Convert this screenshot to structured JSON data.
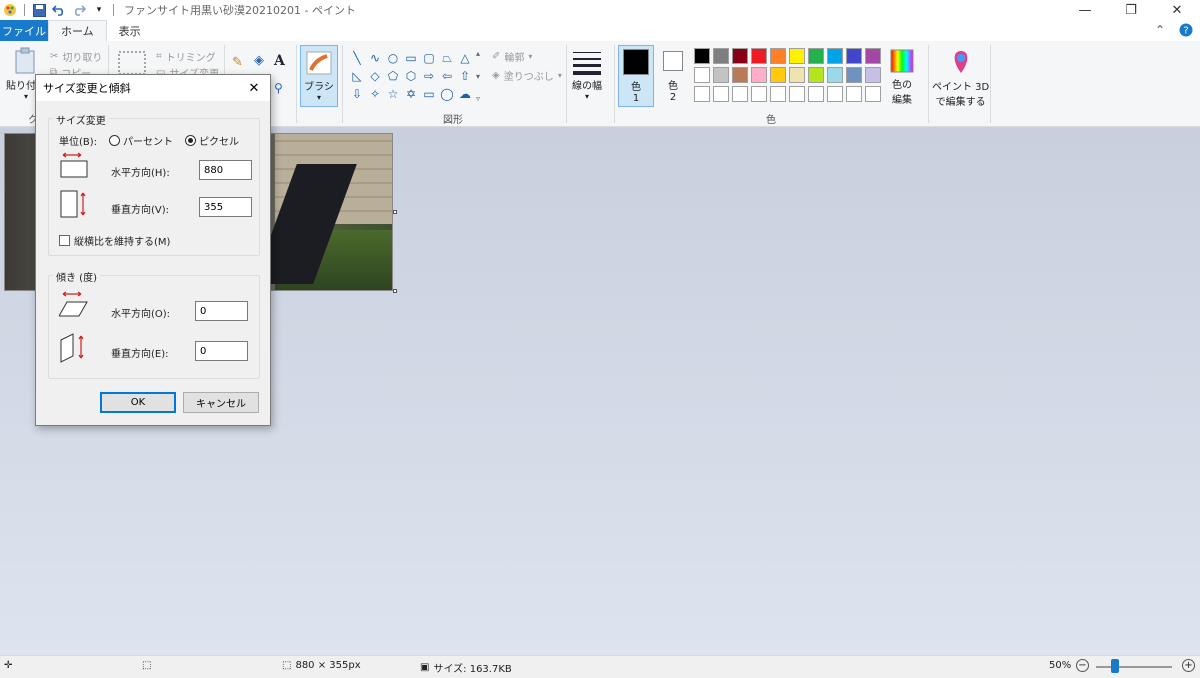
{
  "window": {
    "title": "ファンサイト用黒い砂漠20210201 - ペイント",
    "minimize": "—",
    "restore": "❐",
    "close": "✕"
  },
  "tabs": {
    "file": "ファイル",
    "home": "ホーム",
    "view": "表示"
  },
  "ribbon": {
    "clipboard": {
      "paste": "貼り付け",
      "cut": "切り取り",
      "copy": "コピー",
      "group": "ク"
    },
    "image": {
      "crop": "トリミング",
      "resize": "サイズ変更"
    },
    "brush": "ブラシ",
    "shapes": {
      "group": "図形",
      "outline": "輪郭",
      "fill": "塗りつぶし"
    },
    "line_width": "線の幅",
    "color1": {
      "label": "色",
      "num": "1"
    },
    "color2": {
      "label": "色",
      "num": "2"
    },
    "colors_group": "色",
    "edit_colors": {
      "line1": "色の",
      "line2": "編集"
    },
    "paint3d": {
      "line1": "ペイント 3D",
      "line2": "で編集する"
    },
    "palette_row1": [
      "#000000",
      "#7f7f7f",
      "#880015",
      "#ed1c24",
      "#ff7f27",
      "#fff200",
      "#22b14c",
      "#00a2e8",
      "#3f48cc",
      "#a349a4"
    ],
    "palette_row2": [
      "#ffffff",
      "#c3c3c3",
      "#b97a57",
      "#ffaec9",
      "#ffc90e",
      "#efe4b0",
      "#b5e61d",
      "#99d9ea",
      "#7092be",
      "#c8bfe7"
    ],
    "palette_row3": [
      "#ffffff",
      "#ffffff",
      "#ffffff",
      "#ffffff",
      "#ffffff",
      "#ffffff",
      "#ffffff",
      "#ffffff",
      "#ffffff",
      "#ffffff"
    ]
  },
  "dialog": {
    "title": "サイズ変更と傾斜",
    "close": "✕",
    "resize_legend": "サイズ変更",
    "unit_label": "単位(B):",
    "percent": "パーセント",
    "pixel": "ピクセル",
    "horizontal_label": "水平方向(H):",
    "horizontal_value": "880",
    "vertical_label": "垂直方向(V):",
    "vertical_value": "355",
    "keep_aspect": "縦横比を維持する(M)",
    "skew_legend": "傾き (度)",
    "skew_h_label": "水平方向(O):",
    "skew_h_value": "0",
    "skew_v_label": "垂直方向(E):",
    "skew_v_value": "0",
    "ok": "OK",
    "cancel": "キャンセル"
  },
  "status": {
    "dimensions": "880 × 355px",
    "size": "サイズ: 163.7KB",
    "zoom": "50%",
    "zoom_out": "−",
    "zoom_in": "+"
  }
}
